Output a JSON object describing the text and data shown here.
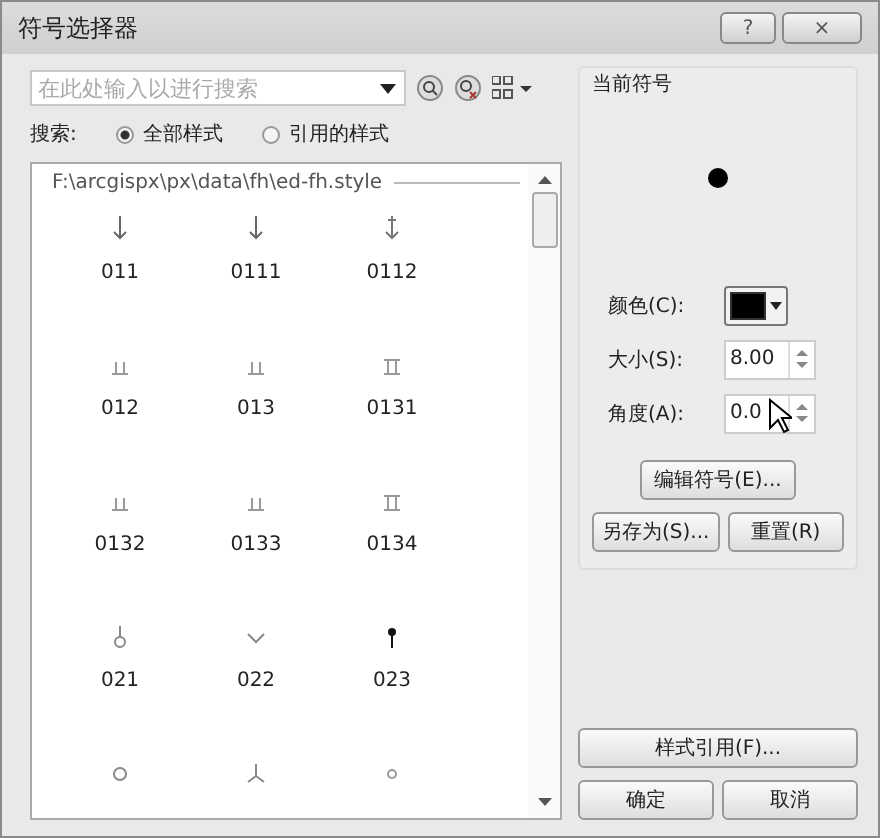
{
  "window": {
    "title": "符号选择器",
    "help": "?",
    "close": "×"
  },
  "search": {
    "placeholder": "在此处输入以进行搜索"
  },
  "scope": {
    "label": "搜索:",
    "options": [
      {
        "label": "全部样式",
        "selected": true
      },
      {
        "label": "引用的样式",
        "selected": false
      }
    ]
  },
  "style_path": "F:\\arcgispx\\px\\data\\fh\\ed-fh.style",
  "symbols": [
    {
      "kind": "arrow",
      "label": "011"
    },
    {
      "kind": "arrow",
      "label": "0111"
    },
    {
      "kind": "arrow2",
      "label": "0112"
    },
    {
      "kind": "comb",
      "label": "012"
    },
    {
      "kind": "comb",
      "label": "013"
    },
    {
      "kind": "comb2",
      "label": "0131"
    },
    {
      "kind": "comb",
      "label": "0132"
    },
    {
      "kind": "comb",
      "label": "0133"
    },
    {
      "kind": "comb2",
      "label": "0134"
    },
    {
      "kind": "ring",
      "label": "021"
    },
    {
      "kind": "vee",
      "label": "022"
    },
    {
      "kind": "pin",
      "label": "023"
    },
    {
      "kind": "circle"
    },
    {
      "kind": "tri"
    },
    {
      "kind": "small-circle"
    }
  ],
  "current": {
    "title": "当前符号",
    "color_label": "颜色(C):",
    "color": "#000000",
    "size_label": "大小(S):",
    "size": "8.00",
    "angle_label": "角度(A):",
    "angle": "0.0"
  },
  "buttons": {
    "edit": "编辑符号(E)...",
    "save_as": "另存为(S)...",
    "reset": "重置(R)",
    "style_ref": "样式引用(F)...",
    "ok": "确定",
    "cancel": "取消"
  }
}
